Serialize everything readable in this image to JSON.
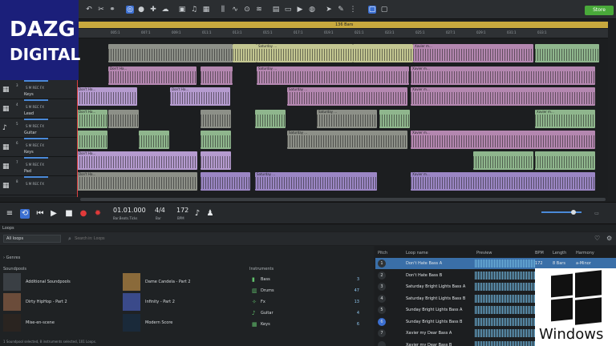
{
  "logo": {
    "line1": "DAZG",
    "line2": "DIGITAL"
  },
  "toolbar": {
    "store_label": "Store",
    "icons": [
      "undo-arrow-icon",
      "cut-icon",
      "link-icon",
      "x-icon",
      "snap-icon",
      "object-icon",
      "puzzle-icon",
      "cloud-icon",
      "image-icon",
      "note-icon",
      "grid-icon",
      "mixer-icon",
      "wave-icon",
      "loop-icon",
      "tuner-icon",
      "film-icon",
      "speaker-icon",
      "volume-icon",
      "pointer-icon",
      "draw-icon",
      "fx-icon",
      "screen-icon",
      "screen2-icon"
    ]
  },
  "timeline": {
    "label": "136 Bars"
  },
  "ruler": [
    "005:1",
    "007:1",
    "009:1",
    "011:1",
    "013:1",
    "015:1",
    "017:1",
    "019:1",
    "021:1",
    "023:1",
    "025:1",
    "027:1",
    "029:1",
    "031:1",
    "033:1"
  ],
  "tracks": [
    {
      "num": "3",
      "name": "Keys",
      "icon": "keyboard-icon",
      "buttons": "S  M  REC  FX"
    },
    {
      "num": "4",
      "name": "Lead",
      "icon": "keyboard-icon",
      "buttons": "S  M  REC  FX"
    },
    {
      "num": "5",
      "name": "Guitar",
      "icon": "guitar-icon",
      "buttons": "S  M  REC  FX"
    },
    {
      "num": "6",
      "name": "Keys",
      "icon": "keyboard-icon",
      "buttons": "S  M  REC  FX"
    },
    {
      "num": "7",
      "name": "Pad",
      "icon": "keyboard-icon",
      "buttons": "S  M  REC  FX"
    },
    {
      "num": "8",
      "name": "",
      "icon": "keyboard-icon",
      "buttons": "S  M  REC  FX"
    }
  ],
  "clip_labels": {
    "dont": "Don't Ha...",
    "saturday": "Saturday ...",
    "xavier": "Xavier m...",
    "sunday": "Sunday B..."
  },
  "transport": {
    "position": "01.01.000",
    "position_sub": "Bar.Beats.Ticks",
    "signature": "4/4",
    "signature_sub": "Bar",
    "bpm": "172",
    "bpm_sub": "BPM"
  },
  "loops": {
    "panel_title": "Loops",
    "filter": "All loops",
    "search_placeholder": "Search in: Loops",
    "genres_label": "Genres",
    "soundpools_label": "Soundpools",
    "instruments_label": "Instruments",
    "soundpools": [
      {
        "name": "Additional Soundpools",
        "color": "#3a3f44"
      },
      {
        "name": "Dirty HipHop - Part 2",
        "color": "#6b4c3a"
      },
      {
        "name": "Mise-en-scene",
        "color": "#2a2420"
      },
      {
        "name": "Dame Candela - Part 2",
        "color": "#8a6a3a"
      },
      {
        "name": "Infinity - Part 2",
        "color": "#3a4a8a"
      },
      {
        "name": "Modern Score",
        "color": "#1a2a3a"
      }
    ],
    "instruments": [
      {
        "name": "Bass",
        "count": "3"
      },
      {
        "name": "Drums",
        "count": "47"
      },
      {
        "name": "Fx",
        "count": "13"
      },
      {
        "name": "Guitar",
        "count": "4"
      },
      {
        "name": "Keys",
        "count": "6"
      }
    ],
    "status": "1 Soundpool selected, 8 instruments selected, 101 Loops.",
    "columns": {
      "pitch": "Pitch",
      "name": "Loop name",
      "preview": "Preview",
      "bpm": "BPM",
      "length": "Length",
      "harmony": "Harmony"
    },
    "rows": [
      {
        "pitch": "1",
        "name": "Don't Hate Bass A",
        "bpm": "172",
        "length": "8 Bars",
        "harmony": "a-Minor"
      },
      {
        "pitch": "2",
        "name": "Don't Hate Bass B",
        "bpm": "",
        "length": "",
        "harmony": ""
      },
      {
        "pitch": "3",
        "name": "Saturday Bright Lights Bass A",
        "bpm": "",
        "length": "",
        "harmony": ""
      },
      {
        "pitch": "4",
        "name": "Saturday Bright Lights Bass B",
        "bpm": "",
        "length": "",
        "harmony": ""
      },
      {
        "pitch": "5",
        "name": "Sunday Bright Lights Bass A",
        "bpm": "",
        "length": "",
        "harmony": ""
      },
      {
        "pitch": "6",
        "name": "Sunday Bright Lights Bass B",
        "bpm": "",
        "length": "",
        "harmony": ""
      },
      {
        "pitch": "7",
        "name": "Xavier my Dear Bass A",
        "bpm": "",
        "length": "",
        "harmony": ""
      },
      {
        "pitch": "",
        "name": "Xavier my Dear Bass B",
        "bpm": "",
        "length": "",
        "harmony": ""
      }
    ]
  },
  "windows_badge": {
    "text": "Windows"
  }
}
